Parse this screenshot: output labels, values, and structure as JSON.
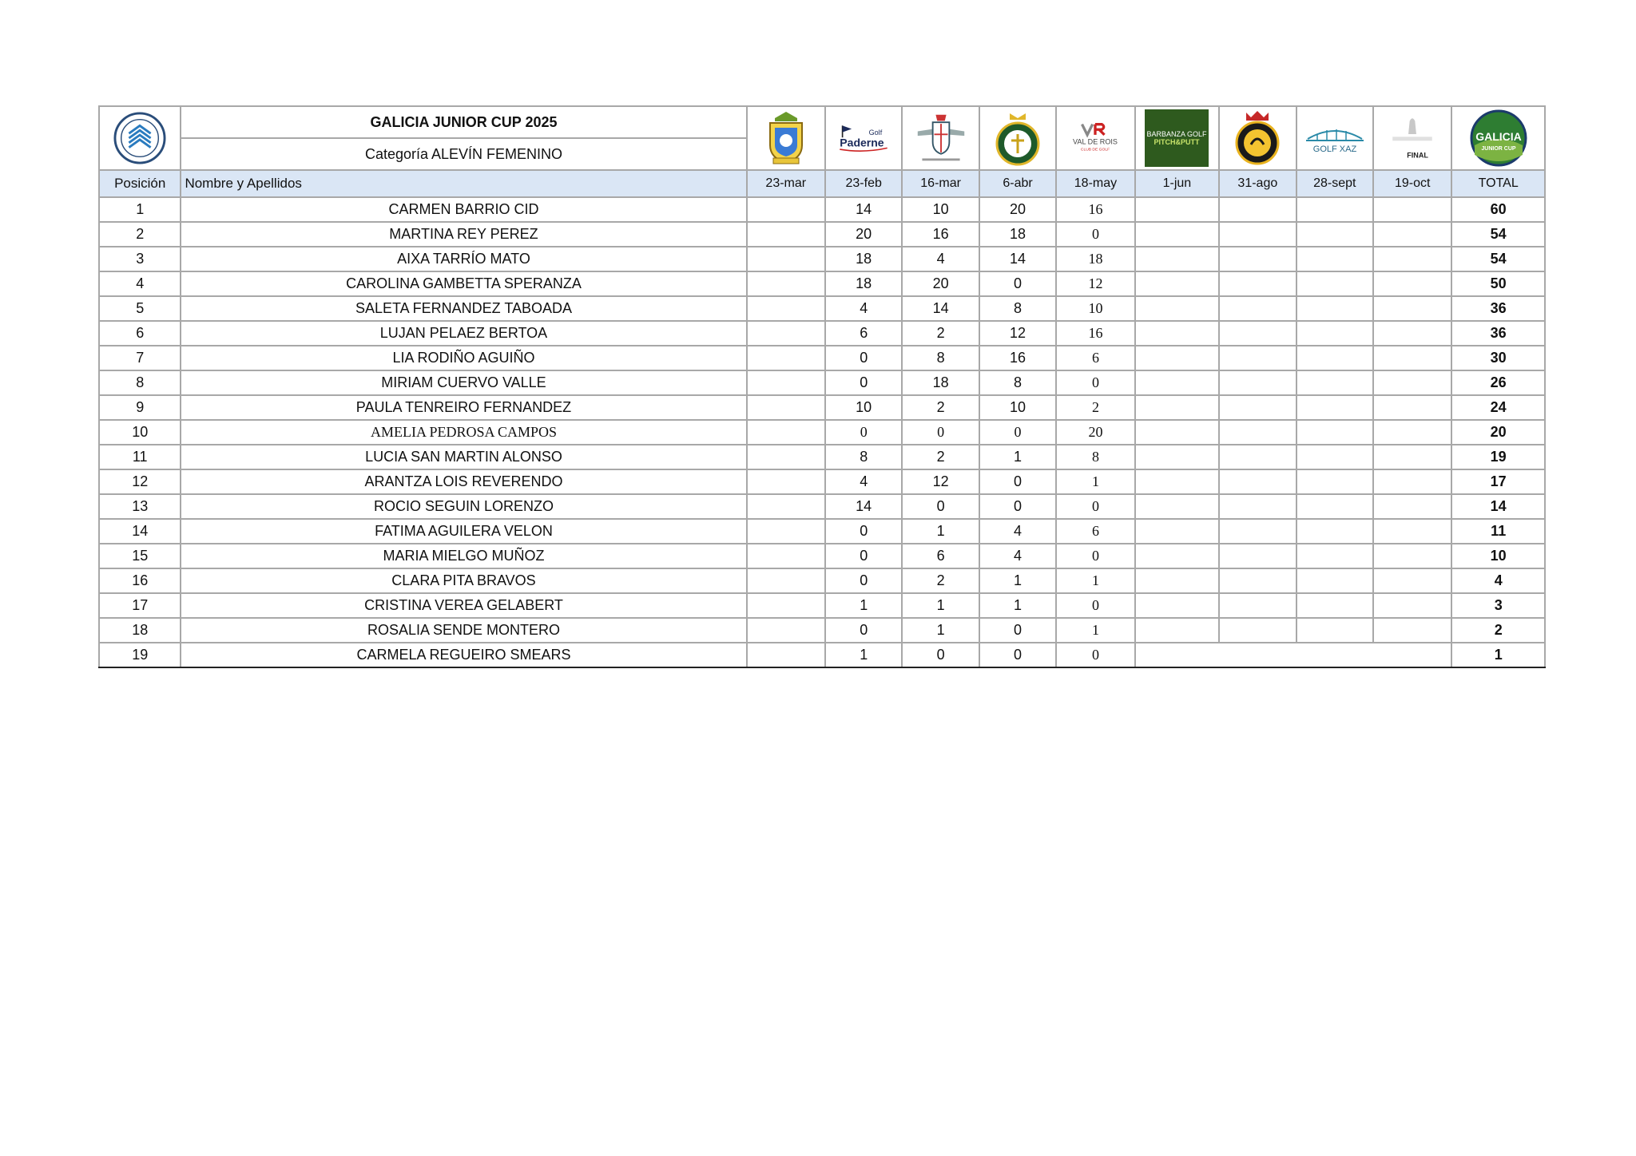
{
  "header": {
    "title": "GALICIA JUNIOR CUP 2025",
    "subtitle": "Categoría ALEVÍN FEMENINO"
  },
  "logos": {
    "federation": "federacion-gallega-golf-logo",
    "paderne_line1": "Golf",
    "paderne_line2": "Paderne",
    "valderois_line1": "VAL DE ROIS",
    "valderois_line2": "CLUB DE GOLF",
    "barbanza_line1": "BARBANZA GOLF",
    "barbanza_line2": "PITCH&PUTT",
    "xaz": "GOLF XAZ",
    "final": "FINAL",
    "gjc_line1": "GALICIA",
    "gjc_line2": "JUNIOR CUP"
  },
  "columns": {
    "position": "Posición",
    "name": "Nombre y Apellidos",
    "dates": [
      "23-mar",
      "23-feb",
      "16-mar",
      "6-abr",
      "18-may",
      "1-jun",
      "31-ago",
      "28-sept",
      "19-oct"
    ],
    "total": "TOTAL"
  },
  "rows": [
    {
      "pos": "1",
      "name": "CARMEN BARRIO CID",
      "s": [
        "",
        "14",
        "10",
        "20",
        "16",
        "",
        "",
        "",
        ""
      ],
      "total": "60"
    },
    {
      "pos": "2",
      "name": "MARTINA REY PEREZ",
      "s": [
        "",
        "20",
        "16",
        "18",
        "0",
        "",
        "",
        "",
        ""
      ],
      "total": "54"
    },
    {
      "pos": "3",
      "name": "AIXA TARRÍO MATO",
      "s": [
        "",
        "18",
        "4",
        "14",
        "18",
        "",
        "",
        "",
        ""
      ],
      "total": "54"
    },
    {
      "pos": "4",
      "name": "CAROLINA GAMBETTA SPERANZA",
      "s": [
        "",
        "18",
        "20",
        "0",
        "12",
        "",
        "",
        "",
        ""
      ],
      "total": "50"
    },
    {
      "pos": "5",
      "name": "SALETA FERNANDEZ TABOADA",
      "s": [
        "",
        "4",
        "14",
        "8",
        "10",
        "",
        "",
        "",
        ""
      ],
      "total": "36"
    },
    {
      "pos": "6",
      "name": "LUJAN PELAEZ BERTOA",
      "s": [
        "",
        "6",
        "2",
        "12",
        "16",
        "",
        "",
        "",
        ""
      ],
      "total": "36"
    },
    {
      "pos": "7",
      "name": "LIA RODIÑO AGUIÑO",
      "s": [
        "",
        "0",
        "8",
        "16",
        "6",
        "",
        "",
        "",
        ""
      ],
      "total": "30"
    },
    {
      "pos": "8",
      "name": "MIRIAM CUERVO VALLE",
      "s": [
        "",
        "0",
        "18",
        "8",
        "0",
        "",
        "",
        "",
        ""
      ],
      "total": "26"
    },
    {
      "pos": "9",
      "name": "PAULA TENREIRO FERNANDEZ",
      "s": [
        "",
        "10",
        "2",
        "10",
        "2",
        "",
        "",
        "",
        ""
      ],
      "total": "24"
    },
    {
      "pos": "10",
      "name": "AMELIA PEDROSA CAMPOS",
      "s": [
        "",
        "0",
        "0",
        "0",
        "20",
        "",
        "",
        "",
        ""
      ],
      "total": "20"
    },
    {
      "pos": "11",
      "name": "LUCIA SAN MARTIN ALONSO",
      "s": [
        "",
        "8",
        "2",
        "1",
        "8",
        "",
        "",
        "",
        ""
      ],
      "total": "19"
    },
    {
      "pos": "12",
      "name": "ARANTZA LOIS REVERENDO",
      "s": [
        "",
        "4",
        "12",
        "0",
        "1",
        "",
        "",
        "",
        ""
      ],
      "total": "17"
    },
    {
      "pos": "13",
      "name": "ROCIO SEGUIN LORENZO",
      "s": [
        "",
        "14",
        "0",
        "0",
        "0",
        "",
        "",
        "",
        ""
      ],
      "total": "14"
    },
    {
      "pos": "14",
      "name": "FATIMA AGUILERA VELON",
      "s": [
        "",
        "0",
        "1",
        "4",
        "6",
        "",
        "",
        "",
        ""
      ],
      "total": "11"
    },
    {
      "pos": "15",
      "name": "MARIA MIELGO MUÑOZ",
      "s": [
        "",
        "0",
        "6",
        "4",
        "0",
        "",
        "",
        "",
        ""
      ],
      "total": "10"
    },
    {
      "pos": "16",
      "name": "CLARA PITA BRAVOS",
      "s": [
        "",
        "0",
        "2",
        "1",
        "1",
        "",
        "",
        "",
        ""
      ],
      "total": "4"
    },
    {
      "pos": "17",
      "name": "CRISTINA VEREA  GELABERT",
      "s": [
        "",
        "1",
        "1",
        "1",
        "0",
        "",
        "",
        "",
        ""
      ],
      "total": "3"
    },
    {
      "pos": "18",
      "name": "ROSALIA SENDE MONTERO",
      "s": [
        "",
        "0",
        "1",
        "0",
        "1",
        "",
        "",
        "",
        ""
      ],
      "total": "2"
    },
    {
      "pos": "19",
      "name": "CARMELA REGUEIRO SMEARS",
      "s": [
        "",
        "1",
        "0",
        "0",
        "0",
        "",
        "",
        "",
        ""
      ],
      "total": "1"
    }
  ],
  "colors": {
    "header_fill": "#dae6f5",
    "grid": "#a8a8a8"
  }
}
